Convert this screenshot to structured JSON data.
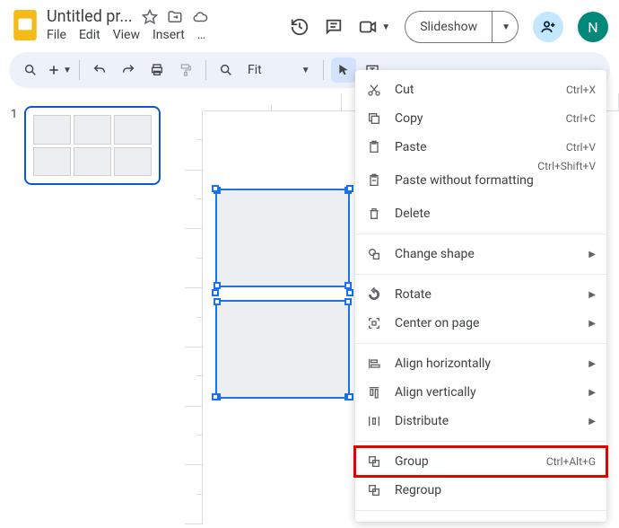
{
  "header": {
    "doc_title": "Untitled pr...",
    "star_icon": "star",
    "move_icon": "move-to-folder",
    "cloud_icon": "cloud-saved",
    "slideshow_label": "Slideshow",
    "avatar_initial": "N"
  },
  "menubar": {
    "file": "File",
    "edit": "Edit",
    "view": "View",
    "insert": "Insert",
    "more": "…"
  },
  "toolbar": {
    "fit_label": "Fit"
  },
  "filmstrip": {
    "slide1_number": "1"
  },
  "context_menu": {
    "cut": {
      "label": "Cut",
      "shortcut": "Ctrl+X"
    },
    "copy": {
      "label": "Copy",
      "shortcut": "Ctrl+C"
    },
    "paste": {
      "label": "Paste",
      "shortcut": "Ctrl+V"
    },
    "paste_wf": {
      "label": "Paste without formatting",
      "shortcut": "Ctrl+Shift+V"
    },
    "delete": {
      "label": "Delete"
    },
    "change_shape": {
      "label": "Change shape"
    },
    "rotate": {
      "label": "Rotate"
    },
    "center_on_page": {
      "label": "Center on page"
    },
    "align_h": {
      "label": "Align horizontally"
    },
    "align_v": {
      "label": "Align vertically"
    },
    "distribute": {
      "label": "Distribute"
    },
    "group": {
      "label": "Group",
      "shortcut": "Ctrl+Alt+G"
    },
    "regroup": {
      "label": "Regroup"
    }
  }
}
